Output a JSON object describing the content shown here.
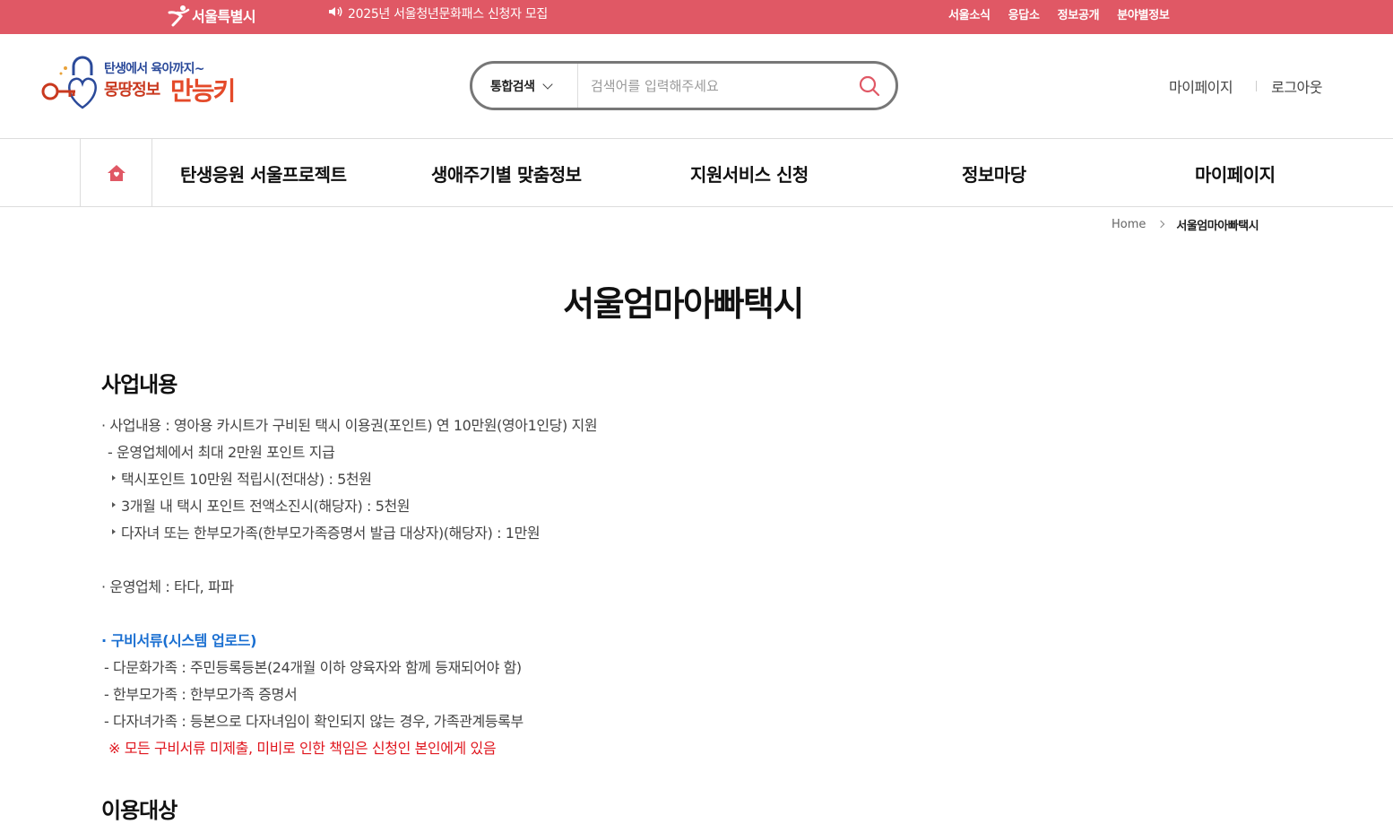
{
  "topbar": {
    "brand": "서울특별시",
    "notice": "2025년 서울청년문화패스 신청자 모집",
    "links": [
      "서울소식",
      "응답소",
      "정보공개",
      "분야별정보"
    ]
  },
  "header": {
    "logo_tagline": "탄생에서 육아까지~",
    "logo_name_1": "몽땅정보",
    "logo_name_2": "만능키",
    "search_scope": "통합검색",
    "search_placeholder": "검색어를 입력해주세요",
    "mypage": "마이페이지",
    "logout": "로그아웃"
  },
  "gnb": [
    "탄생응원 서울프로젝트",
    "생애주기별 맞춤정보",
    "지원서비스 신청",
    "정보마당",
    "마이페이지"
  ],
  "breadcrumb": {
    "home": "Home",
    "current": "서울엄마아빠택시"
  },
  "page_title": "서울엄마아빠택시",
  "section1": {
    "title": "사업내용",
    "lines": [
      "· 사업내용 : 영아용 카시트가 구비된 택시 이용권(포인트) 연 10만원(영아1인당) 지원",
      "- 운영업체에서 최대 2만원 포인트 지급",
      "택시포인트 10만원 적립시(전대상) : 5천원",
      "3개월 내 택시 포인트 전액소진시(해당자) : 5천원",
      "다자녀 또는 한부모가족(한부모가족증명서 발급 대상자)(해당자) : 1만원",
      "· 운영업체 : 타다, 파파",
      "· 구비서류(시스템 업로드)",
      "- 다문화가족 : 주민등록등본(24개월 이하 양육자와 함께 등재되어야 함)",
      "- 한부모가족 : 한부모가족 증명서",
      "- 다자녀가족 : 등본으로 다자녀임이 확인되지 않는 경우, 가족관계등록부",
      "※ 모든 구비서류 미제출, 미비로 인한 책임은 신청인 본인에게 있음"
    ]
  },
  "section2": {
    "title": "이용대상"
  }
}
